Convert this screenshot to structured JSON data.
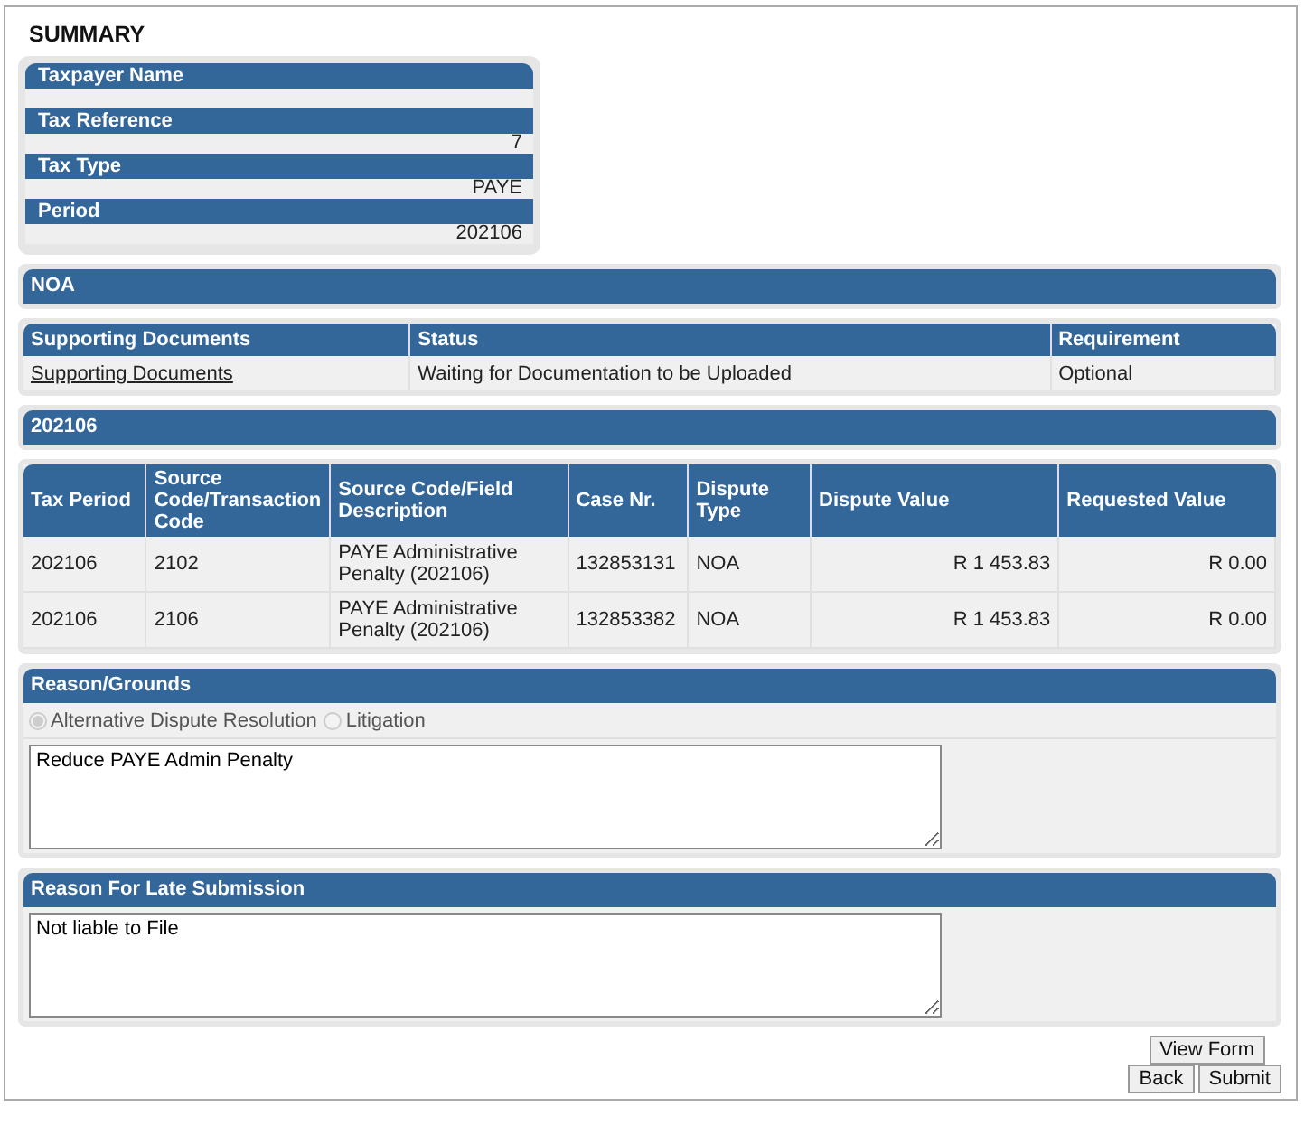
{
  "title": "SUMMARY",
  "summary": [
    {
      "label": "Taxpayer Name"
    },
    {
      "label": "Tax Reference",
      "value": "7"
    },
    {
      "label": "Tax Type",
      "value": "PAYE"
    },
    {
      "label": "Period",
      "value": "202106"
    }
  ],
  "noa_header": "NOA",
  "documents": {
    "columns": [
      "Supporting Documents",
      "Status",
      "Requirement"
    ],
    "rows": [
      {
        "link": "Supporting Documents",
        "status": "Waiting for Documentation to be Uploaded",
        "requirement": "Optional"
      }
    ]
  },
  "period_header": "202106",
  "disputes": {
    "columns": [
      "Tax Period",
      "Source Code/Transaction Code",
      "Source Code/Field Description",
      "Case Nr.",
      "Dispute Type",
      "Dispute Value",
      "Requested Value"
    ],
    "rows": [
      [
        "202106",
        "2102",
        "PAYE Administrative Penalty (202106)",
        "132853131",
        "NOA",
        "R 1 453.83",
        "R 0.00"
      ],
      [
        "202106",
        "2106",
        "PAYE Administrative Penalty (202106)",
        "132853382",
        "NOA",
        "R 1 453.83",
        "R 0.00"
      ]
    ]
  },
  "reason": {
    "title": "Reason/Grounds",
    "options": [
      {
        "label": "Alternative Dispute Resolution",
        "selected": true,
        "disabled": true
      },
      {
        "label": "Litigation",
        "selected": false,
        "disabled": true
      }
    ],
    "text": "Reduce PAYE Admin Penalty"
  },
  "late": {
    "title": "Reason For Late Submission",
    "text": "Not liable to File"
  },
  "view_button": "View Form",
  "buttons": [
    "Back",
    "Submit"
  ]
}
